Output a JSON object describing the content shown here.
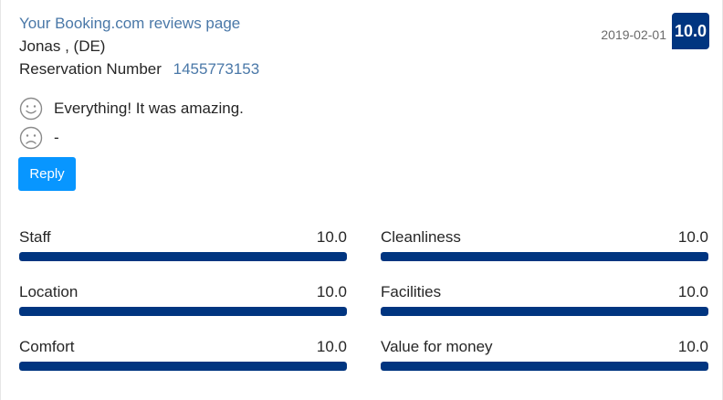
{
  "review": {
    "source_link": "Your Booking.com reviews page",
    "guest": "Jonas , (DE)",
    "reservation_label": "Reservation Number",
    "reservation_number": "1455773153",
    "date": "2019-02-01",
    "score": "10.0",
    "positive_comment": "Everything! It was amazing.",
    "negative_comment": "-",
    "reply_label": "Reply"
  },
  "icons": {
    "positive": "smiley-face-icon",
    "negative": "sad-face-icon"
  },
  "colors": {
    "link": "#4a78a8",
    "score_badge": "#003580",
    "bar_fill": "#003580",
    "reply_button": "#0896ff"
  },
  "scores": [
    {
      "label": "Staff",
      "value": "10.0",
      "fraction": 1.0
    },
    {
      "label": "Cleanliness",
      "value": "10.0",
      "fraction": 1.0
    },
    {
      "label": "Location",
      "value": "10.0",
      "fraction": 1.0
    },
    {
      "label": "Facilities",
      "value": "10.0",
      "fraction": 1.0
    },
    {
      "label": "Comfort",
      "value": "10.0",
      "fraction": 1.0
    },
    {
      "label": "Value for money",
      "value": "10.0",
      "fraction": 1.0
    }
  ]
}
